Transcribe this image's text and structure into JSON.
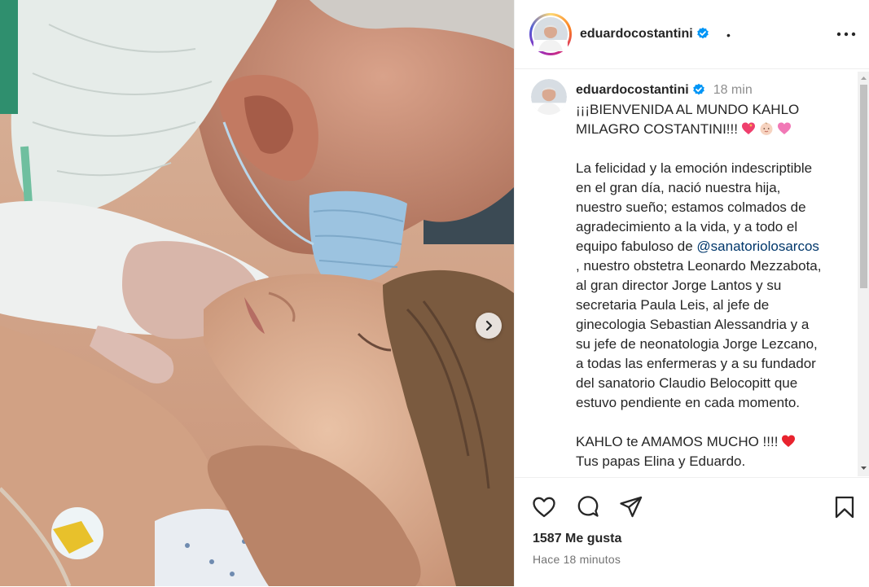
{
  "post": {
    "username": "eduardocostantini",
    "header_separator": "•",
    "caption_time": "18 min",
    "caption_lines": [
      "¡¡¡BIENVENIDA AL MUNDO KAHLO",
      "MILAGRO COSTANTINI!!!",
      "La felicidad y la emoción indescriptible",
      "en el gran día, nació nuestra hija,",
      "nuestro sueño; estamos colmados de",
      "agradecimiento a la vida, y a todo el",
      "equipo fabuloso de",
      "@sanatoriolosarcos",
      ", nuestro obstetra Leonardo Mezzabota,",
      "al gran director Jorge Lantos y su",
      "secretaria Paula Leis, al jefe de",
      "ginecologia Sebastian Alessandria y a",
      "su jefe de neonatologia Jorge Lezcano,",
      "a todas las enfermeras y a su fundador",
      "del sanatorio Claudio Belocopitt que",
      "estuvo pendiente en cada momento.",
      "KAHLO te AMAMOS MUCHO !!!!",
      "Tus papas Elina y Eduardo."
    ],
    "likes_text": "1587 Me gusta",
    "posted_ago": "Hace 18 minutos"
  },
  "icons": {
    "verified": "verified-badge-icon",
    "more": "more-options-icon",
    "next": "chevron-right-icon",
    "like": "heart-icon",
    "comment": "comment-icon",
    "share": "share-icon",
    "save": "bookmark-icon",
    "emoji_1": "sparkling-heart-emoji",
    "emoji_2": "baby-face-emoji",
    "emoji_3": "pink-heart-emoji",
    "emoji_4": "red-heart-emoji"
  },
  "colors": {
    "verified": "#0095f6",
    "mention": "#00376b",
    "muted": "#8e8e8e"
  }
}
